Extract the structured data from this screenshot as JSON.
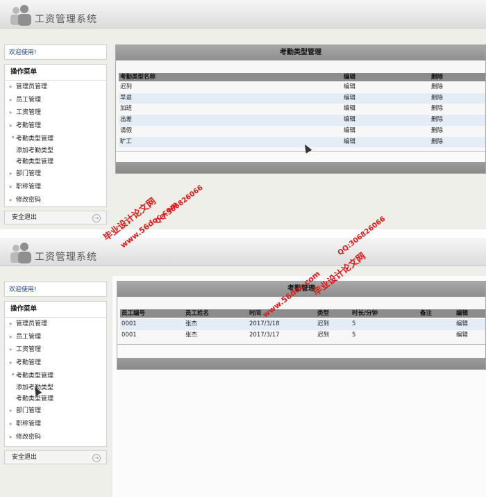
{
  "app": {
    "title": "工资管理系统"
  },
  "sidebar": {
    "welcome": "欢迎使用!",
    "menu_title": "操作菜单",
    "items": [
      {
        "label": "管理员管理",
        "chev": "»"
      },
      {
        "label": "员工管理",
        "chev": "»"
      },
      {
        "label": "工资管理",
        "chev": "»"
      },
      {
        "label": "考勤管理",
        "chev": "»"
      },
      {
        "label": "考勤类型管理",
        "chev": "»"
      }
    ],
    "sub_items": [
      "添加考勤类型",
      "考勤类型管理"
    ],
    "items_after": [
      {
        "label": "部门管理",
        "chev": "»"
      },
      {
        "label": "职称管理",
        "chev": "»"
      },
      {
        "label": "修改密码",
        "chev": "»"
      }
    ],
    "logout": "安全退出"
  },
  "top_panel": {
    "title": "考勤类型管理",
    "columns": [
      "考勤类型名称",
      "编辑",
      "删除"
    ],
    "rows": [
      [
        "迟到",
        "编辑",
        "删除"
      ],
      [
        "早退",
        "编辑",
        "删除"
      ],
      [
        "加班",
        "编辑",
        "删除"
      ],
      [
        "出差",
        "编辑",
        "删除"
      ],
      [
        "请假",
        "编辑",
        "删除"
      ],
      [
        "旷工",
        "编辑",
        "删除"
      ]
    ]
  },
  "bottom_panel": {
    "title": "考勤管理",
    "columns": [
      "员工编号",
      "员工姓名",
      "时间",
      "类型",
      "时长/分钟",
      "备注",
      "编辑"
    ],
    "rows": [
      [
        "0001",
        "张杰",
        "2017/3/18",
        "迟到",
        "5",
        "",
        "编辑"
      ],
      [
        "0001",
        "张杰",
        "2017/3/17",
        "迟到",
        "5",
        "",
        "编辑"
      ]
    ]
  },
  "watermarks": {
    "site_name": "毕业设计论文网",
    "url": "www.56doc.com",
    "qq": "QQ:306826066"
  },
  "colors": {
    "watermark": "#e01818",
    "header_bar": "#8c8c8c",
    "row_alt": "#e4edf6"
  }
}
